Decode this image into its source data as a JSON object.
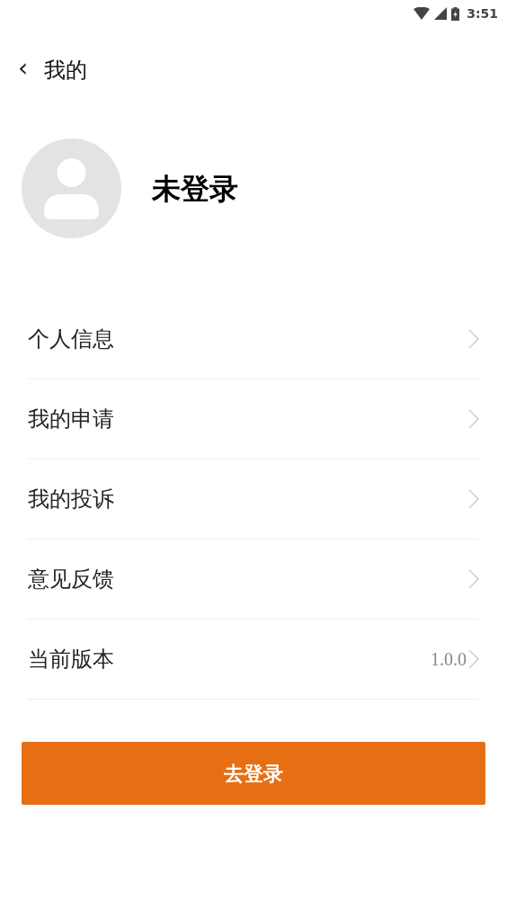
{
  "status_bar": {
    "time": "3:51"
  },
  "header": {
    "back": "‹",
    "title": "我的"
  },
  "profile": {
    "name": "未登录"
  },
  "menu": [
    {
      "label": "个人信息"
    },
    {
      "label": "我的申请"
    },
    {
      "label": "我的投诉"
    },
    {
      "label": "意见反馈"
    },
    {
      "label": "当前版本",
      "value": "1.0.0"
    }
  ],
  "login_button": "去登录"
}
